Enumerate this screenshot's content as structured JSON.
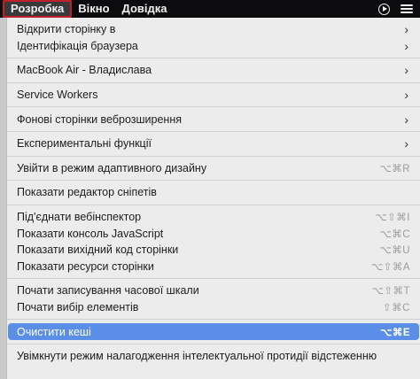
{
  "menubar": {
    "items": [
      "Розробка",
      "Вікно",
      "Довідка"
    ]
  },
  "menu": {
    "groups": [
      [
        {
          "label": "Відкрити сторінку в",
          "submenu": true
        },
        {
          "label": "Ідентифікація браузера",
          "submenu": true
        }
      ],
      [
        {
          "label": "MacBook Air - Владислава",
          "submenu": true
        }
      ],
      [
        {
          "label": "Service Workers",
          "submenu": true
        }
      ],
      [
        {
          "label": "Фонові сторінки веброзширення",
          "submenu": true
        }
      ],
      [
        {
          "label": "Експериментальні функції",
          "submenu": true
        }
      ],
      [
        {
          "label": "Увійти в режим адаптивного дизайну",
          "shortcut": "⌥⌘R"
        }
      ],
      [
        {
          "label": "Показати редактор сніпетів"
        }
      ],
      [
        {
          "label": "Під'єднати вебінспектор",
          "shortcut": "⌥⇧⌘I"
        },
        {
          "label": "Показати консоль JavaScript",
          "shortcut": "⌥⌘C"
        },
        {
          "label": "Показати вихідний код сторінки",
          "shortcut": "⌥⌘U"
        },
        {
          "label": "Показати ресурси сторінки",
          "shortcut": "⌥⇧⌘A"
        }
      ],
      [
        {
          "label": "Почати записування часової шкали",
          "shortcut": "⌥⇧⌘T"
        },
        {
          "label": "Почати вибір елементів",
          "shortcut": "⇧⌘C"
        }
      ],
      [
        {
          "label": "Очистити кеші",
          "shortcut": "⌥⌘E",
          "highlighted": true
        }
      ],
      [
        {
          "label": "Увімкнути режим налагодження інтелектуальної протидії відстеженню"
        }
      ]
    ]
  },
  "icons": {
    "submenu": "chevron-right-icon",
    "status_play": "play-circle-icon",
    "status_control": "control-center-icon"
  },
  "colors": {
    "highlight": "#5b8ee6",
    "active_menu_border": "#c0202a"
  }
}
